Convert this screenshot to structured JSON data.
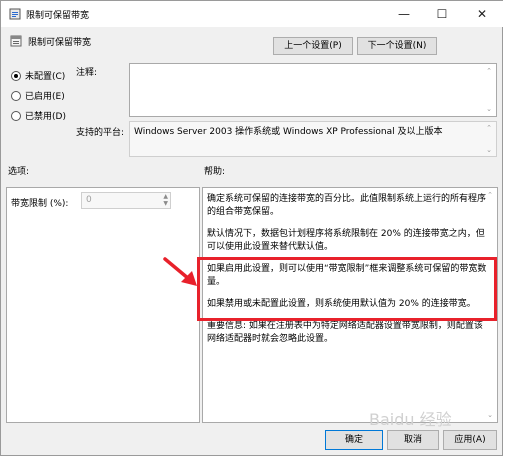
{
  "window": {
    "title": "限制可保留带宽",
    "minimize_icon": "minimize-icon",
    "maximize_icon": "maximize-icon",
    "close_icon": "close-icon"
  },
  "policy_name": "限制可保留带宽",
  "nav": {
    "prev_label": "上一个设置(P)",
    "next_label": "下一个设置(N)"
  },
  "state_options": [
    {
      "label": "未配置(C)",
      "selected": true
    },
    {
      "label": "已启用(E)",
      "selected": false
    },
    {
      "label": "已禁用(D)",
      "selected": false
    }
  ],
  "comment": {
    "label": "注释:",
    "value": ""
  },
  "supported": {
    "label": "支持的平台:",
    "value": "Windows Server 2003 操作系统或 Windows XP Professional 及以上版本"
  },
  "options": {
    "header": "选项:",
    "field_label": "带宽限制 (%):",
    "field_value": "0"
  },
  "help": {
    "header": "帮助:",
    "paragraphs": [
      "确定系统可保留的连接带宽的百分比。此值限制系统上运行的所有程序的组合带宽保留。",
      "默认情况下，数据包计划程序将系统限制在 20% 的连接带宽之内，但可以使用此设置来替代默认值。",
      "如果启用此设置，则可以使用“带宽限制”框来调整系统可保留的带宽数量。",
      "如果禁用或未配置此设置，则系统使用默认值为 20% 的连接带宽。",
      "重要信息: 如果在注册表中为特定网络适配器设置带宽限制，则配置该网络适配器时就会忽略此设置。"
    ]
  },
  "footer": {
    "ok_label": "确定",
    "cancel_label": "取消",
    "apply_label": "应用(A)"
  },
  "watermark": "Baidu 经验",
  "annotation_color": "#e8212b"
}
